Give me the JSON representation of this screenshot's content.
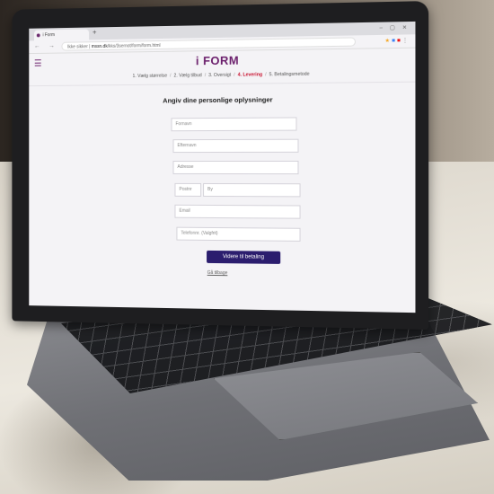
{
  "browser": {
    "tab_title": "i Form",
    "new_tab": "+",
    "security": "Ikke sikker",
    "url_host": "mssn.dk",
    "url_path": "/kks/3sernot/form/form.html"
  },
  "page": {
    "logo": "i FORM",
    "menu_icon": "hamburger-icon",
    "steps": [
      "1. Vælg størrelse",
      "2. Vælg tilbud",
      "3. Oversigt",
      "4. Levering",
      "5. Betalingsmetode"
    ],
    "active_step_index": 3,
    "form_title": "Angiv dine personlige oplysninger",
    "fields": {
      "firstname": "Fornavn",
      "lastname": "Efternavn",
      "address": "Adresse",
      "postal": "Postnr",
      "city": "By",
      "email": "Email",
      "phone": "Telefonnr. (Valgfrit)"
    },
    "submit_label": "Videre til betaling",
    "back_label": "Gå tilbage"
  },
  "colors": {
    "brand": "#6b1f6c",
    "active_step": "#c8102e",
    "button": "#2b1d6e"
  }
}
